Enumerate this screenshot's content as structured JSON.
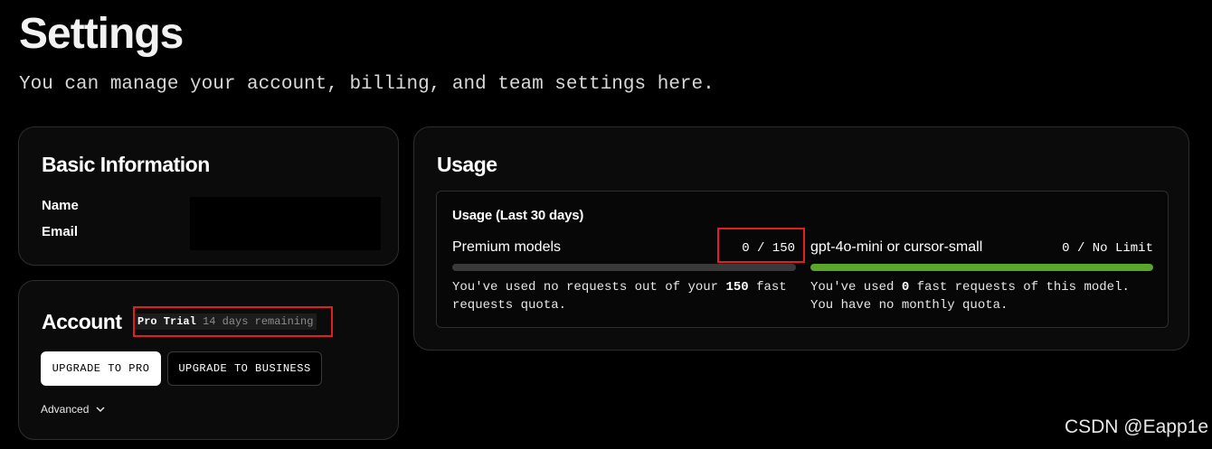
{
  "header": {
    "title": "Settings",
    "subtitle": "You can manage your account, billing, and team settings here."
  },
  "basic_info": {
    "title": "Basic Information",
    "name_label": "Name",
    "email_label": "Email"
  },
  "account": {
    "title": "Account",
    "plan": "Pro Trial",
    "remaining": "14 days remaining",
    "upgrade_pro_label": "UPGRADE TO PRO",
    "upgrade_business_label": "UPGRADE TO BUSINESS",
    "advanced_label": "Advanced",
    "advanced_icon": "chevron-down-icon"
  },
  "usage": {
    "title": "Usage",
    "period_title": "Usage (Last 30 days)",
    "premium": {
      "label": "Premium models",
      "count": "0 / 150",
      "used": 0,
      "limit": 150,
      "progress": 0,
      "desc_prefix": "You've used no requests out of your ",
      "desc_quota": "150",
      "desc_suffix": " fast requests quota."
    },
    "mini": {
      "label": "gpt-4o-mini or cursor-small",
      "count": "0 / No Limit",
      "progress": 1,
      "bar_color": "#5aa62a",
      "desc_prefix": "You've used ",
      "desc_used": "0",
      "desc_suffix": " fast requests of this model. You have no monthly quota."
    }
  },
  "highlight_color": "#e02020",
  "watermark": "CSDN @Eapp1e"
}
